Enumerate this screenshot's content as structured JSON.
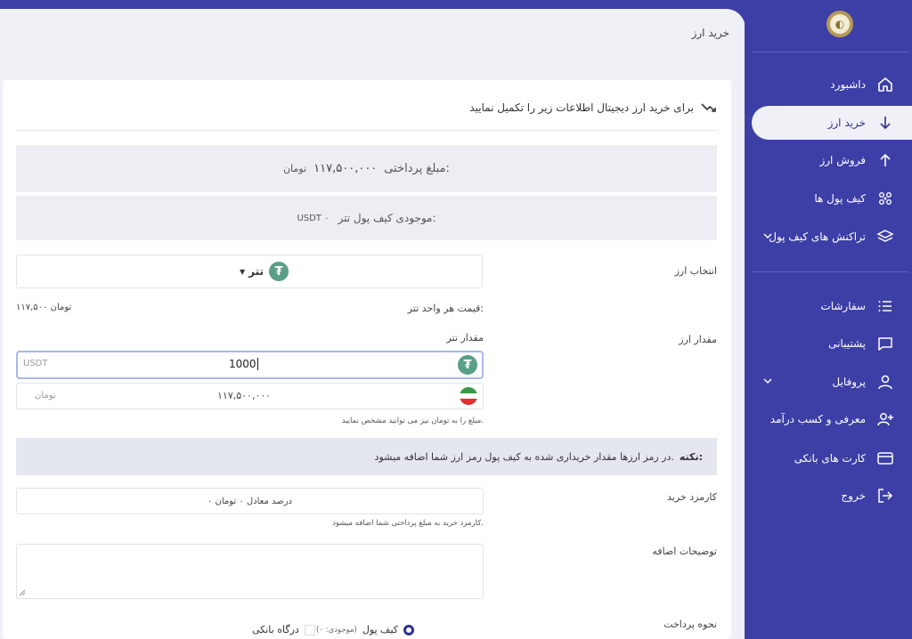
{
  "sidebar": {
    "items": [
      {
        "label": "داشبورد",
        "icon": "home-icon"
      },
      {
        "label": "خرید ارز",
        "icon": "arrow-down-icon",
        "active": true
      },
      {
        "label": "فروش ارز",
        "icon": "arrow-up-icon"
      },
      {
        "label": "کیف پول ها",
        "icon": "wallet-grid-icon"
      },
      {
        "label": "تراکنش های کیف پول",
        "icon": "layers-icon",
        "has_submenu": true
      },
      {
        "label": "سفارشات",
        "icon": "list-icon"
      },
      {
        "label": "پشتیبانی",
        "icon": "chat-icon"
      },
      {
        "label": "پروفایل",
        "icon": "user-icon",
        "has_submenu": true
      },
      {
        "label": "معرفی و کسب درآمد",
        "icon": "user-plus-icon"
      },
      {
        "label": "کارت های بانکی",
        "icon": "card-icon"
      },
      {
        "label": "خروج",
        "icon": "logout-icon"
      }
    ]
  },
  "header": {
    "title": "خرید ارز"
  },
  "form": {
    "intro": "برای خرید ارز دیجیتال اطلاعات زیر را تکمیل نمایید",
    "payment_label": "مبلغ پرداختی:",
    "payment_value": "۱۱۷,۵۰۰,۰۰۰",
    "payment_unit": "تومان",
    "balance_label": "موجودی کیف پول تتر:",
    "balance_value": "USDT ۰",
    "currency_label": "انتخاب ارز",
    "currency_value": "تتر",
    "unit_price_label": "قیمت هر واحد تتر:",
    "unit_price_value": "۱۱۷,۵۰۰ تومان",
    "amount_label": "مقدار ارز",
    "amount_sub_label": "مقدار تتر",
    "amount_value": "1000",
    "amount_placeholder": "USDT",
    "toman_value": "۱۱۷,۵۰۰,۰۰۰",
    "toman_placeholder": "تومان",
    "toman_hint": "مبلغ را به تومان نیز می توانید مشخص نمایید.",
    "note_title": "نکته:",
    "note_text": "در رمز ارزها مقدار خریداری شده به کیف پول رمز ارز شما اضافه میشود.",
    "fee_label": "کارمزد خرید",
    "fee_value": "۰ درصد معادل ۰ تومان",
    "fee_hint": "کارمزد خرید به مبلغ پرداختی شما اضافه میشود.",
    "desc_label": "توضیحات اضافه",
    "payment_method_label": "نحوه پرداخت",
    "method_gateway": "درگاه بانکی",
    "method_wallet": "کیف پول",
    "method_wallet_balance": "(موجودی: ۰)"
  },
  "colors": {
    "sidebar": "#3d3fa6",
    "accent": "#2e2f8c",
    "tether": "#5a9e86"
  }
}
